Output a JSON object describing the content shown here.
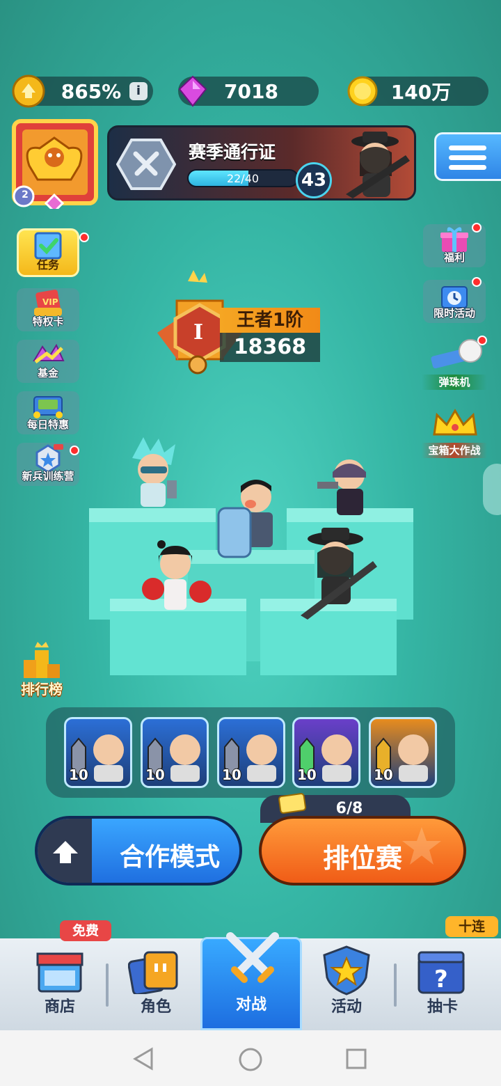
{
  "resources": {
    "trophy_pct": "865%",
    "gems": "7018",
    "coins": "140万"
  },
  "profile": {
    "level": "2"
  },
  "season_pass": {
    "title": "赛季通行证",
    "progress_text": "22/40",
    "progress_fraction": 0.55,
    "level": "43"
  },
  "left_menu": {
    "task": "任务",
    "vip": "特权卡",
    "fund": "基金",
    "daily": "每日特惠",
    "rookie": "新兵训练营",
    "leaderboard": "排行榜"
  },
  "right_menu": {
    "welfare": "福利",
    "limited": "限时活动",
    "pinball": "弹珠机",
    "chest_battle": "宝箱大作战"
  },
  "rank": {
    "roman": "I",
    "name": "王者1阶",
    "score": "18368"
  },
  "team": [
    {
      "level": "10",
      "color": "#2c6fd6",
      "gem": "#8a93a8"
    },
    {
      "level": "10",
      "color": "#2c6fd6",
      "gem": "#8a93a8"
    },
    {
      "level": "10",
      "color": "#2c6fd6",
      "gem": "#8a93a8"
    },
    {
      "level": "10",
      "color": "#6a3fc9",
      "gem": "#4fcf6b"
    },
    {
      "level": "10",
      "color": "#e88c1e",
      "gem": "#e8b02a"
    }
  ],
  "modes": {
    "coop": "合作模式",
    "ranked": "排位赛",
    "ranked_tickets": "6/8"
  },
  "nav": {
    "shop": "商店",
    "shop_tag": "免费",
    "hero": "角色",
    "battle": "对战",
    "event": "活动",
    "draw": "抽卡",
    "draw_tag": "十连"
  }
}
